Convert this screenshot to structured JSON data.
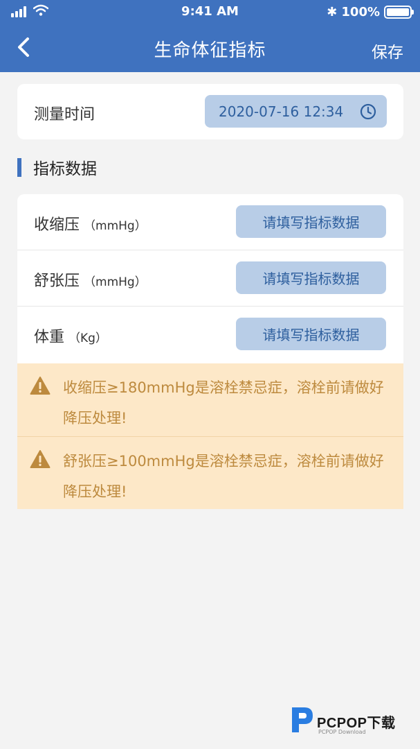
{
  "status_bar": {
    "time": "9:41 AM",
    "bluetooth": "✱",
    "battery": "100%"
  },
  "nav": {
    "title": "生命体征指标",
    "save_label": "保存"
  },
  "measure": {
    "label": "测量时间",
    "value": "2020-07-16  12:34"
  },
  "section": {
    "title": "指标数据"
  },
  "indicators": [
    {
      "label": "收缩压",
      "unit": "（mmHg）",
      "button": "请填写指标数据"
    },
    {
      "label": "舒张压",
      "unit": "（mmHg）",
      "button": "请填写指标数据"
    },
    {
      "label": "体重",
      "unit": "（Kg）",
      "button": "请填写指标数据"
    }
  ],
  "warnings": [
    {
      "text": "收缩压≥180mmHg是溶栓禁忌症，溶栓前请做好降压处理!"
    },
    {
      "text": "舒张压≥100mmHg是溶栓禁忌症，溶栓前请做好降压处理!"
    }
  ],
  "watermark": {
    "brand": "PCPOP下载",
    "sub": "PCPOP Download"
  },
  "colors": {
    "header": "#3f72bf",
    "button_bg": "#b8cde7",
    "button_text": "#2e5f9e",
    "warning_bg": "#fde8c8",
    "warning_text": "#bd8a3e"
  }
}
